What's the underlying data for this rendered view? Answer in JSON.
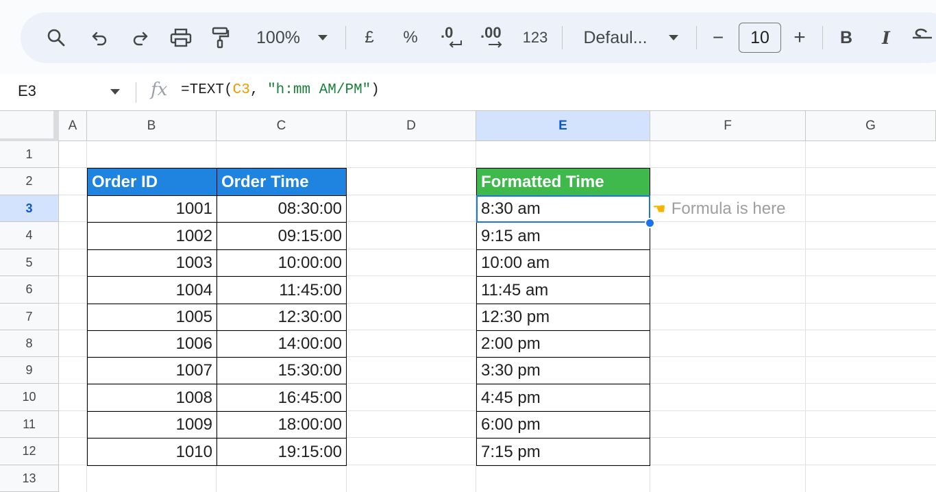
{
  "toolbar": {
    "zoom": "100%",
    "currency": "£",
    "percent": "%",
    "dec_decrease": ".0",
    "dec_increase": ".00",
    "number_format": "123",
    "font": "Defaul...",
    "font_size": "10",
    "minus": "−",
    "plus": "+",
    "bold": "B",
    "italic": "I",
    "icons": [
      "search-icon",
      "undo-icon",
      "redo-icon",
      "print-icon",
      "paint-format-icon",
      "chevron-down-icon",
      "strikethrough-icon"
    ]
  },
  "formula_bar": {
    "name_box": "E3",
    "fx": "fx",
    "formula_prefix": "=TEXT(",
    "formula_ref": "C3",
    "formula_mid": ", ",
    "formula_string": "\"h:mm AM/PM\"",
    "formula_suffix": ")"
  },
  "sheet": {
    "columns": [
      "A",
      "B",
      "C",
      "D",
      "E",
      "F",
      "G"
    ],
    "active_column": "E",
    "rows": [
      "1",
      "2",
      "3",
      "4",
      "5",
      "6",
      "7",
      "8",
      "9",
      "10",
      "11",
      "12",
      "13"
    ],
    "active_row": "3",
    "headers": {
      "order_id": "Order ID",
      "order_time": "Order Time",
      "formatted_time": "Formatted Time"
    },
    "data": [
      {
        "id": "1001",
        "time": "08:30:00",
        "formatted": "8:30 am"
      },
      {
        "id": "1002",
        "time": "09:15:00",
        "formatted": "9:15 am"
      },
      {
        "id": "1003",
        "time": "10:00:00",
        "formatted": "10:00 am"
      },
      {
        "id": "1004",
        "time": "11:45:00",
        "formatted": "11:45 am"
      },
      {
        "id": "1005",
        "time": "12:30:00",
        "formatted": "12:30 pm"
      },
      {
        "id": "1006",
        "time": "14:00:00",
        "formatted": "2:00 pm"
      },
      {
        "id": "1007",
        "time": "15:30:00",
        "formatted": "3:30 pm"
      },
      {
        "id": "1008",
        "time": "16:45:00",
        "formatted": "4:45 pm"
      },
      {
        "id": "1009",
        "time": "18:00:00",
        "formatted": "6:00 pm"
      },
      {
        "id": "1010",
        "time": "19:15:00",
        "formatted": "7:15 pm"
      }
    ],
    "note": "Formula is here",
    "note_icon": "pointing-hand-icon"
  },
  "colors": {
    "header_blue": "#1f84e0",
    "header_green": "#3fb94b",
    "selection": "#1a73e8"
  }
}
